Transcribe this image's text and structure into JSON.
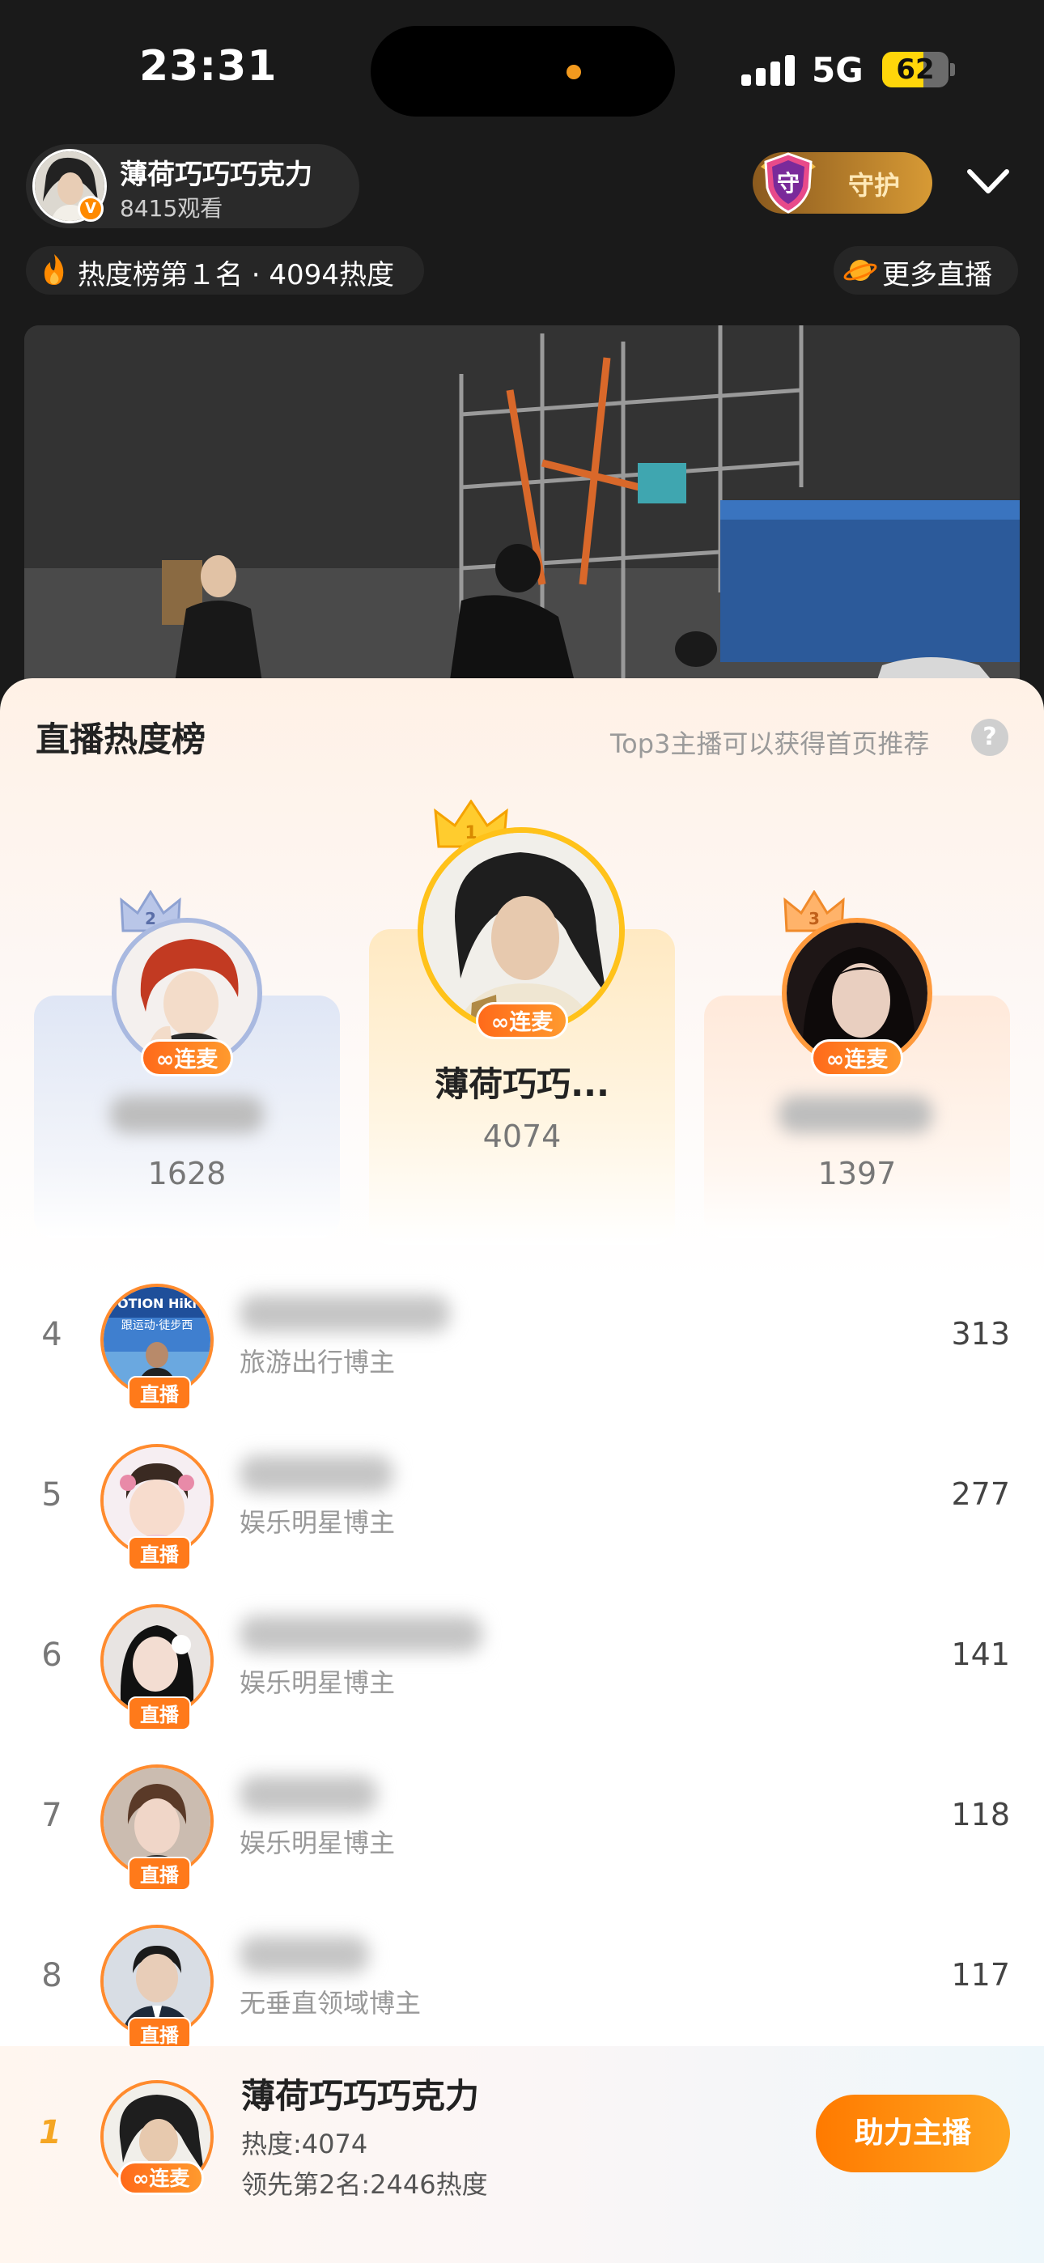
{
  "status_bar": {
    "time": "23:31",
    "network": "5G",
    "battery": "62",
    "battery_level": 0.62
  },
  "host": {
    "name": "薄荷巧巧巧克力",
    "viewers": "8415观看",
    "verified_badge": "V"
  },
  "guard": {
    "label": "守护",
    "badge_char": "守"
  },
  "heat_pill": {
    "text": "热度榜第１名 · 4094热度",
    "icon": "fire-icon"
  },
  "more_live": {
    "text": "更多直播",
    "icon": "planet-icon"
  },
  "sheet": {
    "title": "直播热度榜",
    "tip": "Top3主播可以获得首页推荐",
    "help": "?"
  },
  "top3": [
    {
      "rank": "1",
      "name": "薄荷巧巧...",
      "score": "4074",
      "tag": "连麦"
    },
    {
      "rank": "2",
      "name": "",
      "score": "1628",
      "tag": "连麦"
    },
    {
      "rank": "3",
      "name": "",
      "score": "1397",
      "tag": "连麦"
    }
  ],
  "list": [
    {
      "rank": "4",
      "category": "旅游出行博主",
      "score": "313",
      "tag": "直播",
      "avatar_text": "OTION Hiki",
      "avatar_sub": "跟运动·徒步西"
    },
    {
      "rank": "5",
      "category": "娱乐明星博主",
      "score": "277",
      "tag": "直播"
    },
    {
      "rank": "6",
      "category": "娱乐明星博主",
      "score": "141",
      "tag": "直播"
    },
    {
      "rank": "7",
      "category": "娱乐明星博主",
      "score": "118",
      "tag": "直播"
    },
    {
      "rank": "8",
      "category": "无垂直领域博主",
      "score": "117",
      "tag": "直播"
    }
  ],
  "me": {
    "rank": "1",
    "name": "薄荷巧巧巧克力",
    "heat": "热度:4074",
    "lead": "领先第2名:2446热度",
    "tag": "连麦",
    "boost_button": "助力主播"
  },
  "colors": {
    "accent_orange": "#ff7a1a",
    "gold": "#f5a623",
    "background": "#1a1a1a"
  }
}
